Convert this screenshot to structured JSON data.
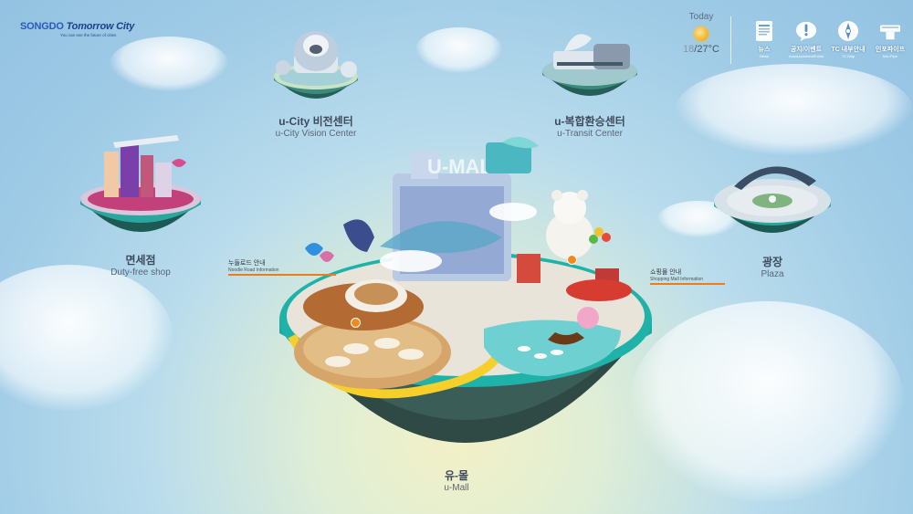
{
  "brand": {
    "name_1": "SONGDO",
    "name_2": "Tomorrow City",
    "tagline": "You can see the future of cities"
  },
  "weather": {
    "label": "Today",
    "low": "18",
    "high": "/27°C",
    "icon": "sunny-icon"
  },
  "top_nav": [
    {
      "ko": "뉴스",
      "en": "News",
      "icon": "newspaper-icon"
    },
    {
      "ko": "공지/이벤트",
      "en": "Announcement/Event",
      "icon": "exclamation-bubble-icon"
    },
    {
      "ko": "TC 내부안내",
      "en": "TC Map",
      "icon": "compass-icon"
    },
    {
      "ko": "인포파이프",
      "en": "Info-Pipe",
      "icon": "pipe-icon"
    }
  ],
  "places": {
    "vision_center": {
      "ko": "u-City 비전센터",
      "en": "u-City Vision Center"
    },
    "transit_center": {
      "ko": "u-복합환승센터",
      "en": "u-Transit Center"
    },
    "duty_free": {
      "ko": "면세점",
      "en": "Duty-free shop"
    },
    "plaza": {
      "ko": "광장",
      "en": "Plaza"
    },
    "umall": {
      "ko": "유-몰",
      "en": "u-Mall",
      "sign": "U-MALL"
    }
  },
  "pointers": {
    "noodle": {
      "ko": "누들로드 안내",
      "en": "Noodle Road Information"
    },
    "shopping": {
      "ko": "쇼핑몰 안내",
      "en": "Shopping Mall Information"
    }
  },
  "colors": {
    "accent_orange": "#f07b1a",
    "island_teal": "#1fa9a3",
    "sky": "#9fcbe6"
  }
}
